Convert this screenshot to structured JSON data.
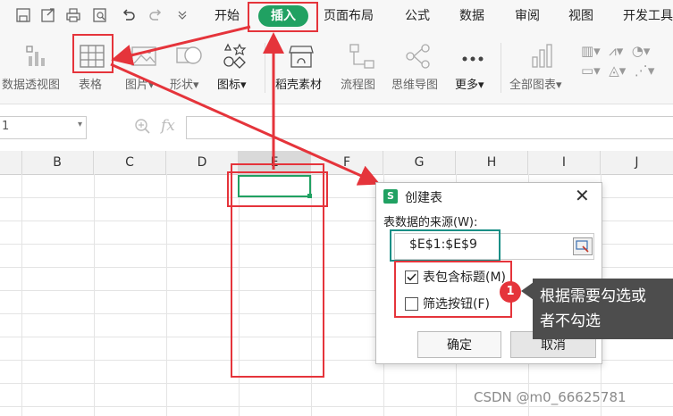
{
  "toolbar": {
    "tabs": [
      "开始",
      "插入",
      "页面布局",
      "公式",
      "数据",
      "审阅",
      "视图",
      "开发工具"
    ],
    "active_tab": "插入"
  },
  "ribbon": {
    "items": [
      "数据透视图",
      "表格",
      "图片",
      "形状",
      "图标",
      "稻壳素材",
      "流程图",
      "思维导图",
      "更多",
      "全部图表"
    ]
  },
  "formula_bar": {
    "name_box": "1",
    "fx": "fx"
  },
  "grid": {
    "columns": [
      "B",
      "C",
      "D",
      "E",
      "F",
      "G",
      "H",
      "I",
      "J"
    ]
  },
  "dialog": {
    "title": "创建表",
    "source_label": "表数据的来源(W):",
    "range_value": "$E$1:$E$9",
    "has_header_label": "表包含标题(M)",
    "has_header_checked": true,
    "filter_label": "筛选按钮(F)",
    "filter_checked": false,
    "ok_label": "确定",
    "cancel_label": "取消"
  },
  "annotation": {
    "badge": "1",
    "tooltip_line1": "根据需要勾选或",
    "tooltip_line2": "者不勾选"
  },
  "watermark": "CSDN @m0_66625781",
  "colors": {
    "accent_green": "#20a162",
    "annotation_red": "#e5343b",
    "teal_highlight": "#1a8f86"
  }
}
